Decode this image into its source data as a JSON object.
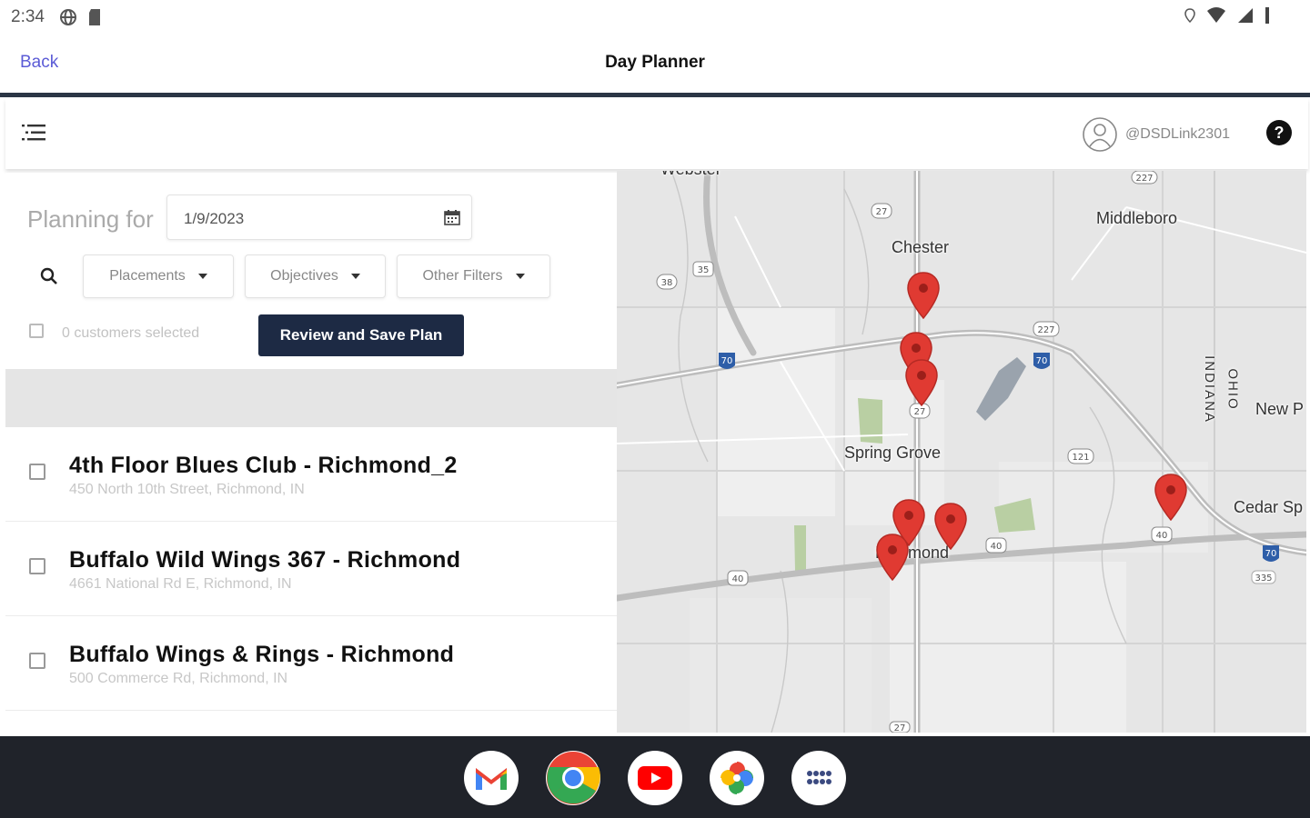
{
  "status_bar": {
    "time": "2:34"
  },
  "header": {
    "back_label": "Back",
    "title": "Day Planner"
  },
  "toolbar": {
    "username": "@DSDLink2301",
    "help_label": "?"
  },
  "planner": {
    "planning_label": "Planning for",
    "date_value": "1/9/2023",
    "filters": [
      "Placements",
      "Objectives",
      "Other Filters"
    ],
    "selected_count": "0 customers selected",
    "review_button": "Review and Save Plan"
  },
  "customers": [
    {
      "name": "4th Floor Blues Club - Richmond_2",
      "address": "450 North 10th Street, Richmond, IN"
    },
    {
      "name": "Buffalo Wild Wings 367 - Richmond",
      "address": "4661 National Rd E, Richmond, IN"
    },
    {
      "name": "Buffalo Wings & Rings - Richmond",
      "address": "500 Commerce Rd, Richmond, IN"
    }
  ],
  "map": {
    "places": {
      "webster": "Webster",
      "chester": "Chester",
      "middleboro": "Middleboro",
      "spring_grove": "Spring Grove",
      "richmond": "Richmond",
      "new_paris": "New P",
      "cedar": "Cedar Sp",
      "indiana": "INDIANA",
      "ohio": "OHIO"
    },
    "shields": {
      "s27": "27",
      "s35": "35",
      "s38": "38",
      "s227": "227",
      "i70": "70",
      "s121": "121",
      "s40": "40",
      "s335": "335",
      "s227b": "227"
    },
    "pin_color": "#e03a32"
  },
  "dock": [
    "gmail-icon",
    "chrome-icon",
    "youtube-icon",
    "photos-icon",
    "app-launcher-icon"
  ]
}
